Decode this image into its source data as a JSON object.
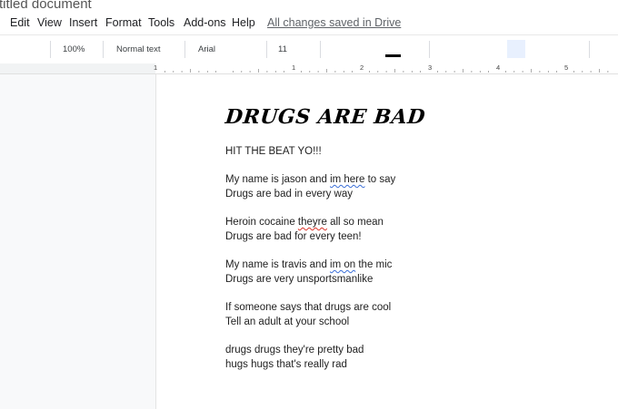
{
  "window": {
    "doc_title": "titled document"
  },
  "menu": {
    "items": [
      "Edit",
      "View",
      "Insert",
      "Format",
      "Tools",
      "Add-ons",
      "Help"
    ],
    "save_status": "All changes saved in Drive"
  },
  "toolbar": {
    "zoom": "100%",
    "style": "Normal text",
    "font": "Arial",
    "size": "11"
  },
  "ruler": {
    "numbers": [
      "1",
      "1",
      "2",
      "3",
      "4",
      "5"
    ]
  },
  "document": {
    "heading": "DRUGS ARE BAD",
    "intro": "HIT THE BEAT YO!!!",
    "stanzas": [
      {
        "line1_a": "My name is jason and ",
        "line1_flag": "im here",
        "line1_b": " to say",
        "line2": "Drugs are bad in every way"
      },
      {
        "line1_a": "Heroin cocaine ",
        "line1_flag": "theyre",
        "line1_b": " all so mean",
        "line2": "Drugs are bad for every teen!"
      },
      {
        "line1_a": "My name is travis and ",
        "line1_flag": "im on",
        "line1_b": " the mic",
        "line2": "Drugs are very unsportsmanlike"
      },
      {
        "line1": "If someone says that drugs are cool",
        "line2": "Tell an adult at your school"
      },
      {
        "line1": "drugs drugs they're pretty bad",
        "line2": "hugs hugs that's really rad"
      }
    ]
  },
  "colors": {
    "spelling_underline": "#3b6fd8",
    "grammar_underline": "#d93025",
    "highlight_button": "#e8f0fe"
  }
}
